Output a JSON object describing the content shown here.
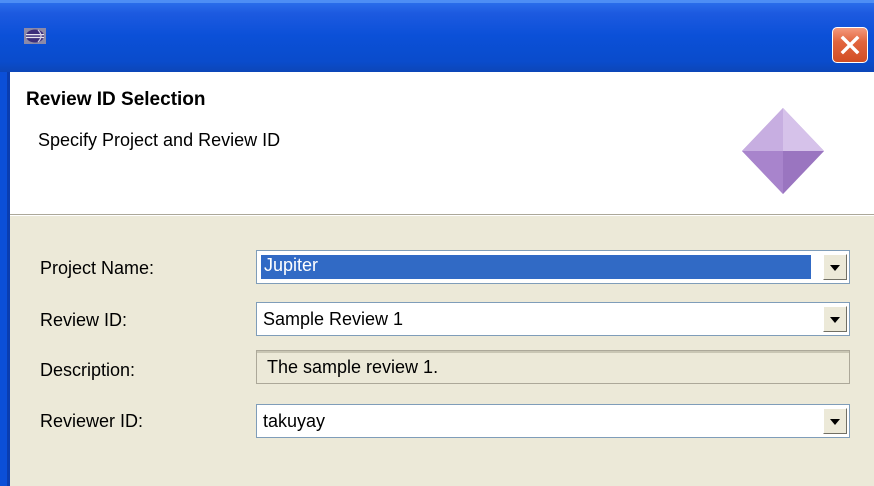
{
  "dialog": {
    "close_label": "Close",
    "header": {
      "title": "Review ID Selection",
      "subtitle": "Specify Project and Review ID"
    }
  },
  "form": {
    "project_name": {
      "label": "Project Name:",
      "value": "Jupiter"
    },
    "review_id": {
      "label": "Review ID:",
      "value": "Sample Review 1"
    },
    "description": {
      "label": "Description:",
      "value": "The sample review 1."
    },
    "reviewer_id": {
      "label": "Reviewer ID:",
      "value": "takuyay"
    }
  },
  "colors": {
    "titlebar": "#0b50d8",
    "selection": "#316ac5",
    "dialog_bg": "#ece9d8",
    "close_button": "#e2653e"
  },
  "icons": {
    "app": "eclipse-app-icon",
    "close": "close-icon",
    "wizard": "wizard-diamond-icon",
    "dropdown": "dropdown-arrow-icon"
  }
}
